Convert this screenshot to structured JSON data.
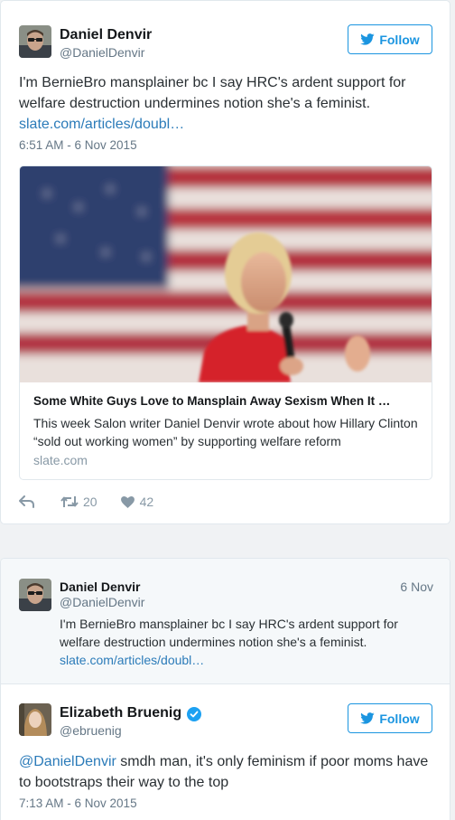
{
  "tweet": {
    "author_name": "Daniel Denvir",
    "author_handle": "@DanielDenvir",
    "follow_label": "Follow",
    "text": "I'm BernieBro mansplainer bc I say HRC's ardent support for welfare destruction undermines notion she's a feminist.",
    "link": "slate.com/articles/doubl…",
    "timestamp": "6:51 AM - 6 Nov 2015",
    "card": {
      "title": "Some White Guys Love to Mansplain Away Sexism When It …",
      "description": "This week Salon writer Daniel Denvir wrote about how Hillary Clinton “sold out working women” by supporting welfare reform",
      "domain": "slate.com"
    },
    "retweets": "20",
    "likes": "42"
  },
  "conversation": {
    "quoted": {
      "author_name": "Daniel Denvir",
      "author_handle": "@DanielDenvir",
      "date": "6 Nov",
      "text": "I'm BernieBro mansplainer bc I say HRC's ardent support for welfare destruction undermines notion she's a feminist.",
      "link": "slate.com/articles/doubl…"
    },
    "reply": {
      "author_name": "Elizabeth Bruenig",
      "author_handle": "@ebruenig",
      "follow_label": "Follow",
      "mention": "@DanielDenvir",
      "text": " smdh man, it's only feminism if poor moms have to bootstraps their way to the top",
      "timestamp": "7:13 AM - 6 Nov 2015"
    }
  },
  "colors": {
    "accent": "#1b95e0",
    "link": "#2b7bb9",
    "verified": "#1da1f2",
    "muted": "#657786"
  },
  "icons": [
    "twitter-bird-icon",
    "reply-icon",
    "retweet-icon",
    "heart-icon",
    "verified-badge-icon"
  ]
}
